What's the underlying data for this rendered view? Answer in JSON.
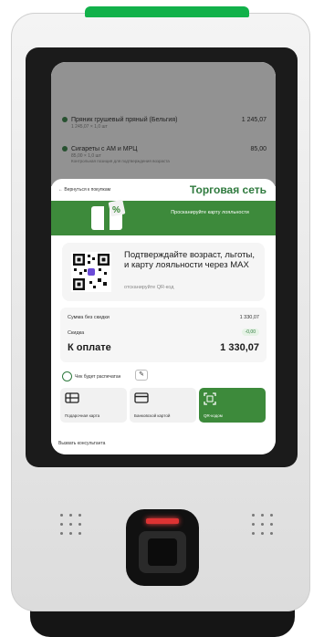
{
  "colors": {
    "accent": "#3d8a3b",
    "brand_green": "#2f7a3e",
    "led": "#12b14a",
    "scanner_red": "#d33333"
  },
  "background_list": [
    {
      "name": "Пряник грушевый пряный (Бельгия)",
      "sub": "1 245,07 × 1,0 шт",
      "price": "1 245,07"
    },
    {
      "name": "Сигареты с АМ и МРЦ",
      "sub": "85,00 × 1,0 шт",
      "warn": "Контрольная позиция для подтверждения возраста",
      "price": "85,00"
    }
  ],
  "header": {
    "back_label": "Вернуться к покупкам",
    "brand": "Торговая сеть"
  },
  "banner": {
    "text": "Просканируйте карту лояльности"
  },
  "maxcard": {
    "title": "Подтверждайте возраст, льготы, и карту лояльности через MAX",
    "subtitle": "отсканируйте QR-код"
  },
  "totals": {
    "no_discount_label": "Сумма без скидки",
    "no_discount_value": "1 330,07",
    "discount_label": "Скидка",
    "discount_value": "-0,00",
    "pay_label": "К оплате",
    "pay_value": "1 330,07"
  },
  "receipt": {
    "label": "Чек будет распечатан"
  },
  "payment_methods": [
    {
      "label": "Подарочная карта",
      "icon": "gift-card-icon"
    },
    {
      "label": "Банковской картой",
      "icon": "bank-card-icon"
    },
    {
      "label": "QR-кодом",
      "icon": "qr-scan-icon"
    }
  ],
  "footer": {
    "call_label": "Вызвать консультанта"
  }
}
